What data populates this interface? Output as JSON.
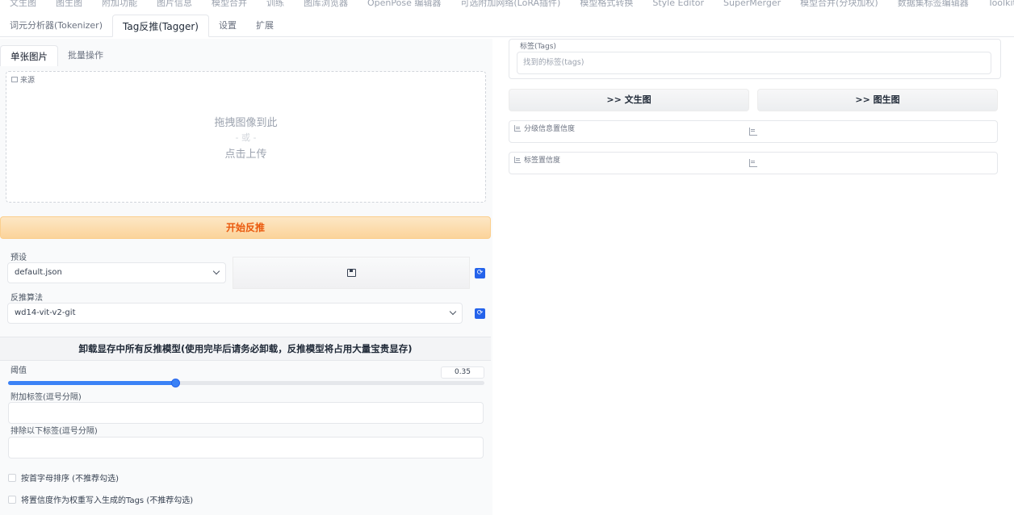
{
  "top_tabs": [
    "文生图",
    "图生图",
    "附加功能",
    "图片信息",
    "模型合并",
    "训练",
    "图库浏览器",
    "OpenPose 编辑器",
    "可选附加网络(LoRA插件)",
    "模型格式转换",
    "Style Editor",
    "SuperMerger",
    "模型合并(分块加权)",
    "数据集标签编辑器",
    "Toolkit"
  ],
  "sub_tabs": [
    {
      "label": "词元分析器(Tokenizer)",
      "active": false
    },
    {
      "label": "Tag反推(Tagger)",
      "active": true
    },
    {
      "label": "设置",
      "active": false
    },
    {
      "label": "扩展",
      "active": false
    }
  ],
  "inner_tabs": [
    {
      "label": "单张图片",
      "active": true
    },
    {
      "label": "批量操作",
      "active": false
    }
  ],
  "upload": {
    "label": "来源",
    "drop_text": "拖拽图像到此",
    "or_text": "- 或 -",
    "click_text": "点击上传"
  },
  "start_button": "开始反推",
  "preset": {
    "label": "预设",
    "value": "default.json"
  },
  "interrogator": {
    "label": "反推算法",
    "value": "wd14-vit-v2-git"
  },
  "unload_button": "卸载显存中所有反推模型(使用完毕后请务必卸载，反推模型将占用大量宝贵显存)",
  "threshold": {
    "label": "阈值",
    "value": "0.35",
    "fraction": 0.35
  },
  "additional_tags": {
    "label": "附加标签(逗号分隔)"
  },
  "exclude_tags": {
    "label": "排除以下标签(逗号分隔)"
  },
  "checks": [
    {
      "label": "按首字母排序 (不推荐勾选)",
      "checked": false
    },
    {
      "label": "将置信度作为权重写入生成的Tags (不推荐勾选)",
      "checked": false
    }
  ],
  "tags_output": {
    "label": "标签(Tags)",
    "placeholder": "找到的标签(tags)"
  },
  "send_txt2img": ">> 文生图",
  "send_img2img": ">> 图生图",
  "rating_confidence": {
    "label": "分级信息置信度"
  },
  "tag_confidence": {
    "label": "标签置信度"
  },
  "colors": {
    "accent": "#3b82f6",
    "primary_button": "#fbd39a",
    "primary_text": "#ea580c"
  }
}
